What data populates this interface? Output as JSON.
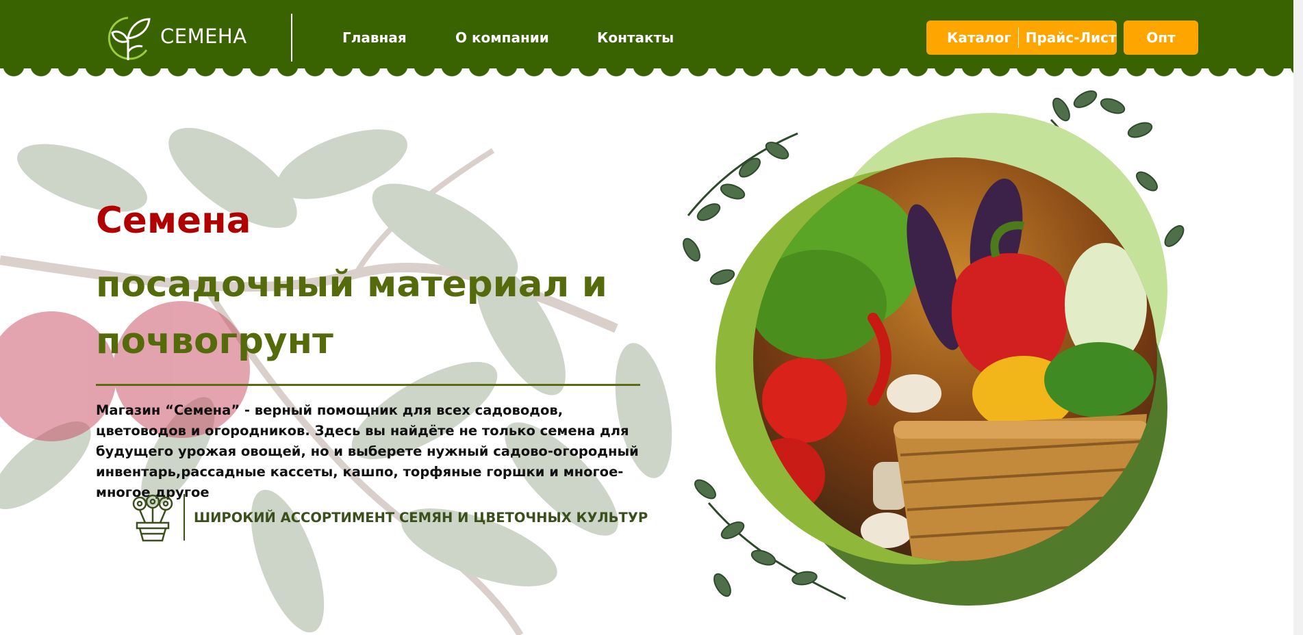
{
  "header": {
    "logo_text": "СЕМЕНА",
    "nav": [
      {
        "label": "Главная"
      },
      {
        "label": "О компании"
      },
      {
        "label": "Контакты"
      }
    ],
    "buttons": {
      "catalog": "Каталог",
      "price_list": "Прайс-Лист",
      "wholesale": "Опт"
    }
  },
  "hero": {
    "title_line1": "Семена",
    "title_line2": "посадочный материал и почвогрунт",
    "description": "Магазин “Семена” - верный помощник для всех садоводов, цветоводов и огородников. Здесь вы найдёте не только семена для будущего урожая овощей, но и выберете нужный садово-огородный инвентарь,рассадные кассеты, кашпо, торфяные горшки и многое-многое другое",
    "feature": "ШИРОКИЙ АССОРТИМЕНТ СЕМЯН И ЦВЕТОЧНЫХ КУЛЬТУР"
  },
  "colors": {
    "header_bg": "#386300",
    "accent_orange": "#ffa500",
    "title_red": "#b00000",
    "title_olive": "#556b0b"
  },
  "icons": [
    "sprout-logo-icon",
    "flower-pot-icon",
    "vegetable-basket-image",
    "apple-branch-image"
  ]
}
